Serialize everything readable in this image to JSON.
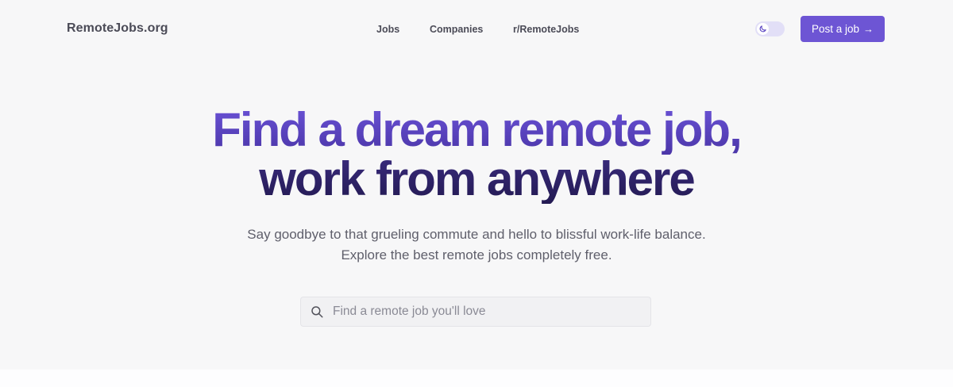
{
  "header": {
    "logo": "RemoteJobs.org",
    "nav": [
      "Jobs",
      "Companies",
      "r/RemoteJobs"
    ],
    "theme_toggle_icon": "moon-icon",
    "post_button_label": "Post a job",
    "post_button_arrow": "→"
  },
  "hero": {
    "title_line1": "Find a dream remote job,",
    "title_line2": "work from anywhere",
    "subtitle_line1": "Say goodbye to that grueling commute and hello to blissful work-life balance.",
    "subtitle_line2": "Explore the best remote jobs completely free."
  },
  "search": {
    "placeholder": "Find a remote job you'll love",
    "value": "",
    "icon": "search-icon"
  },
  "colors": {
    "accent": "#6d55d4",
    "title_top": "#5b45c2",
    "title_bottom": "#2a1f5e",
    "background": "#f7f7f8"
  }
}
